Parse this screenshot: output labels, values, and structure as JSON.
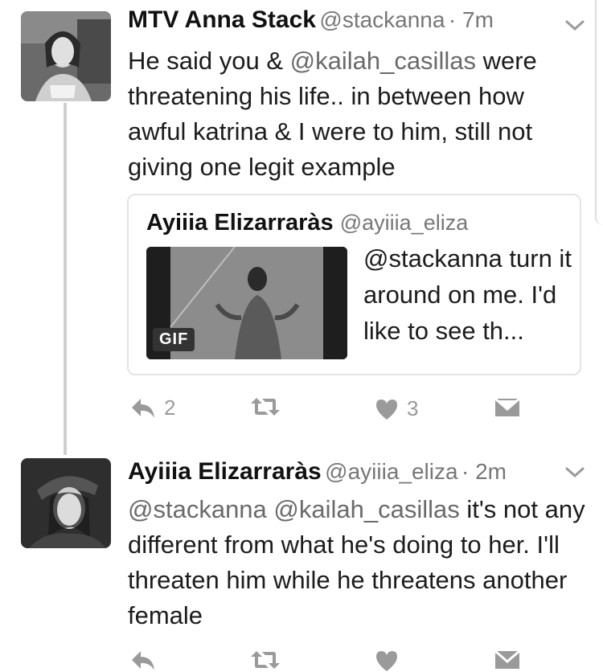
{
  "tweets": [
    {
      "author": "MTV Anna Stack",
      "handle": "@stackanna",
      "time": "· 7m",
      "text_mention": "@kailah_casillas",
      "text_pre": "He said you & ",
      "text_post": " were threatening his life.. in between how awful katrina & I were to him, still not giving one legit example",
      "quote": {
        "author": "Ayiiia Elizarraràs",
        "handle": "@ayiiia_eliza",
        "text": "@stackanna turn it around on me. I'd like to see th...",
        "media_badge": "GIF"
      },
      "actions": {
        "replies": "2",
        "likes": "3"
      }
    },
    {
      "author": "Ayiiia Elizarraràs",
      "handle": "@ayiiia_eliza",
      "time": "· 2m",
      "mentions": "@stackanna @kailah_casillas",
      "text_post": " it's not any different from what he's doing to her. I'll threaten him while he threatens another female",
      "actions": {
        "replies": "",
        "likes": ""
      }
    }
  ],
  "icons": [
    "reply-icon",
    "retweet-icon",
    "heart-icon",
    "message-icon",
    "chevron-down-icon"
  ],
  "colors": {
    "text": "#1c1c1c",
    "muted": "#777777",
    "border": "#e4e4e4"
  }
}
